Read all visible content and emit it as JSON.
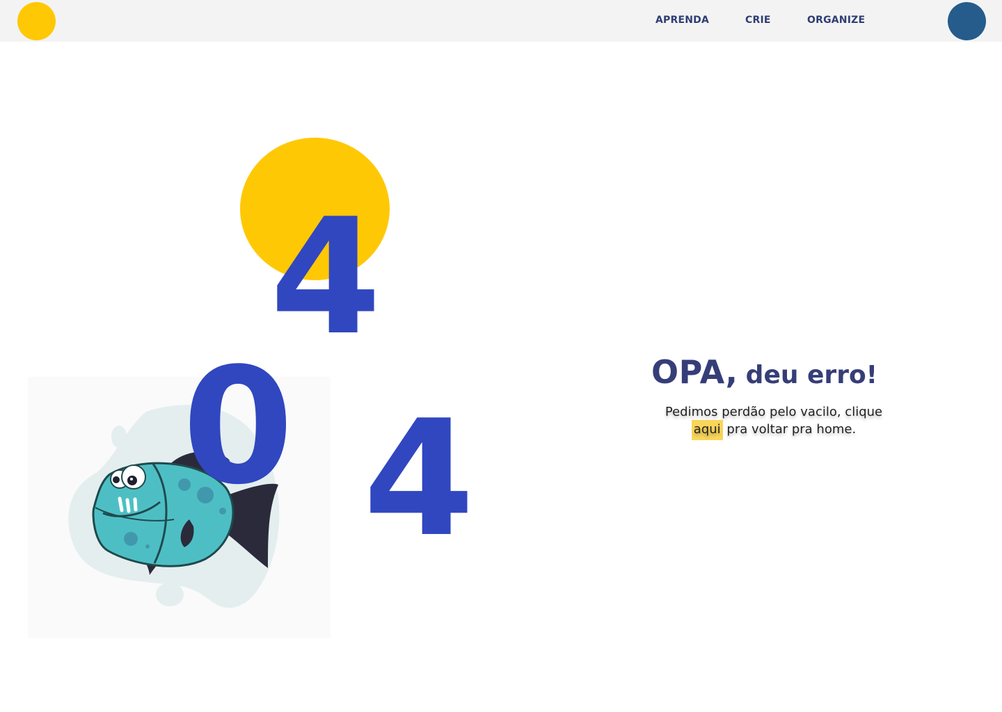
{
  "colors": {
    "accent_yellow": "#FFC805",
    "primary_blue": "#3047C0",
    "nav_text": "#2F3E73",
    "avatar_blue": "#255C8C",
    "title_text": "#363E78",
    "link_highlight": "#F9D65A",
    "fish_body": "#4DBFC4",
    "fish_fin": "#2B2A3A",
    "blob": "#E4EEEF"
  },
  "header": {
    "logo_icon": "yellow-circle-logo",
    "nav": [
      {
        "label": "APRENDA"
      },
      {
        "label": "CRIE"
      },
      {
        "label": "ORGANIZE"
      }
    ],
    "avatar_icon": "user-avatar-circle"
  },
  "error": {
    "code_digits": [
      "4",
      "0",
      "4"
    ],
    "title_emphasis": "OPA,",
    "title_rest": "deu erro!",
    "message_before": "Pedimos perdão pelo vacilo, clique",
    "link_label": "aqui",
    "message_after": " pra voltar pra home."
  },
  "illustration": {
    "icon": "cartoon-fish-icon"
  }
}
